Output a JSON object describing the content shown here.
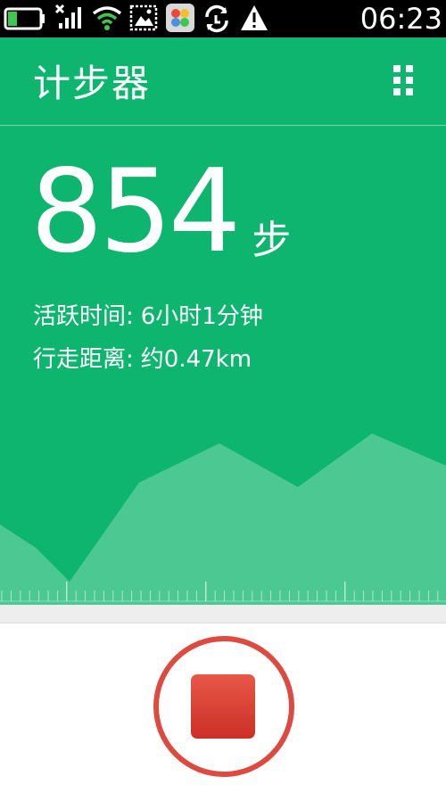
{
  "status_bar": {
    "time": "06:23",
    "icons": [
      "battery-icon",
      "cellular-signal-icon",
      "wifi-icon",
      "gallery-notification-icon",
      "app-notification-icon",
      "sync-icon",
      "warning-icon"
    ]
  },
  "app": {
    "title": "计步器",
    "menu_icon": "grid-menu-icon"
  },
  "steps": {
    "value": "854",
    "unit": "步"
  },
  "stats": {
    "active_time_label": "活跃时间:",
    "active_time_value": "6小时1分钟",
    "distance_label": "行走距离:",
    "distance_value": "约0.47km"
  },
  "controls": {
    "stop_icon": "stop-icon"
  },
  "colors": {
    "primary_green": "#0eb56f",
    "chart_fill": "#4cc893",
    "stop_red": "#d9362c",
    "ring_red": "#dc4a40"
  }
}
